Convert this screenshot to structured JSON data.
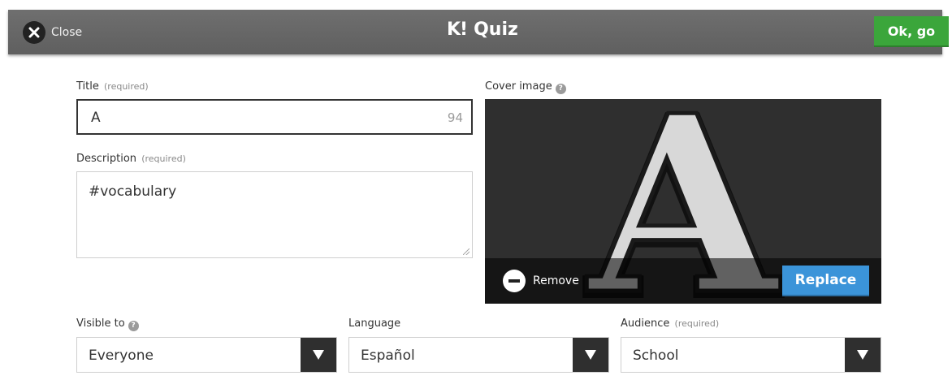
{
  "topbar": {
    "close_label": "Close",
    "brand_mark": "K!",
    "title": "Quiz",
    "ok_label": "Ok, go"
  },
  "form": {
    "title": {
      "label": "Title",
      "required": "(required)",
      "value": "A",
      "remaining": "94"
    },
    "description": {
      "label": "Description",
      "required": "(required)",
      "value": "#vocabulary"
    },
    "cover": {
      "label": "Cover image",
      "image_letter": "A",
      "remove_label": "Remove",
      "replace_label": "Replace"
    },
    "visible_to": {
      "label": "Visible to",
      "value": "Everyone"
    },
    "language": {
      "label": "Language",
      "value": "Español"
    },
    "audience": {
      "label": "Audience",
      "required": "(required)",
      "value": "School"
    }
  },
  "colors": {
    "topbar": "#666666",
    "ok_button": "#3ba63b",
    "replace_button": "#3b94d9",
    "cover_bg": "#303030"
  }
}
